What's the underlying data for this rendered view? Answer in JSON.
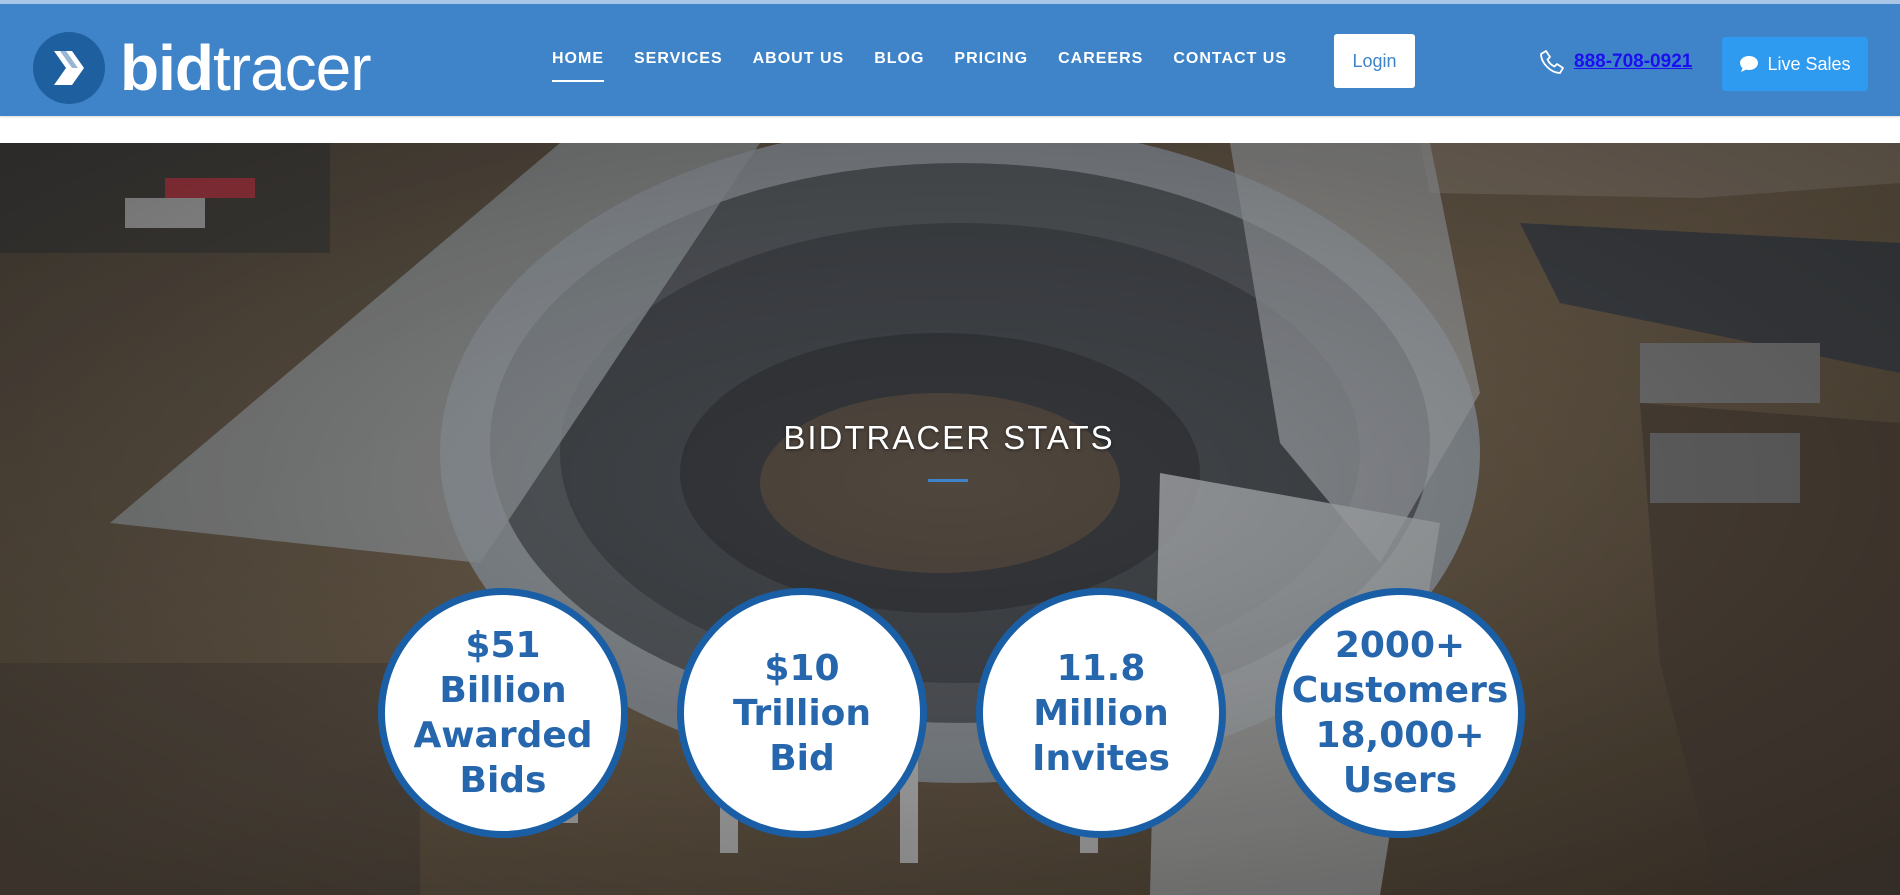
{
  "header": {
    "logo": {
      "bold": "bid",
      "light": "tracer"
    },
    "nav": [
      {
        "label": "HOME",
        "active": true
      },
      {
        "label": "SERVICES"
      },
      {
        "label": "ABOUT US"
      },
      {
        "label": "BLOG"
      },
      {
        "label": "PRICING"
      },
      {
        "label": "CAREERS"
      },
      {
        "label": "CONTACT US"
      }
    ],
    "login_label": "Login",
    "phone": "888-708-0921",
    "live_sales_label": "Live Sales"
  },
  "hero": {
    "title": "BIDTRACER STATS",
    "stats": [
      {
        "text": "$51\nBillion\nAwarded\nBids"
      },
      {
        "text": "$10\nTrillion\nBid"
      },
      {
        "text": "11.8\nMillion\nInvites"
      },
      {
        "text": "2000+\nCustomers\n18,000+\nUsers"
      }
    ]
  },
  "colors": {
    "header_bg": "#3f84c8",
    "accent": "#2e9af0",
    "stat_border": "#1a5fa6",
    "stat_text": "#2566ad"
  },
  "icons": {
    "logo": "bidtracer-logo-mark",
    "phone": "phone-icon",
    "chat": "chat-bubble-icon"
  }
}
